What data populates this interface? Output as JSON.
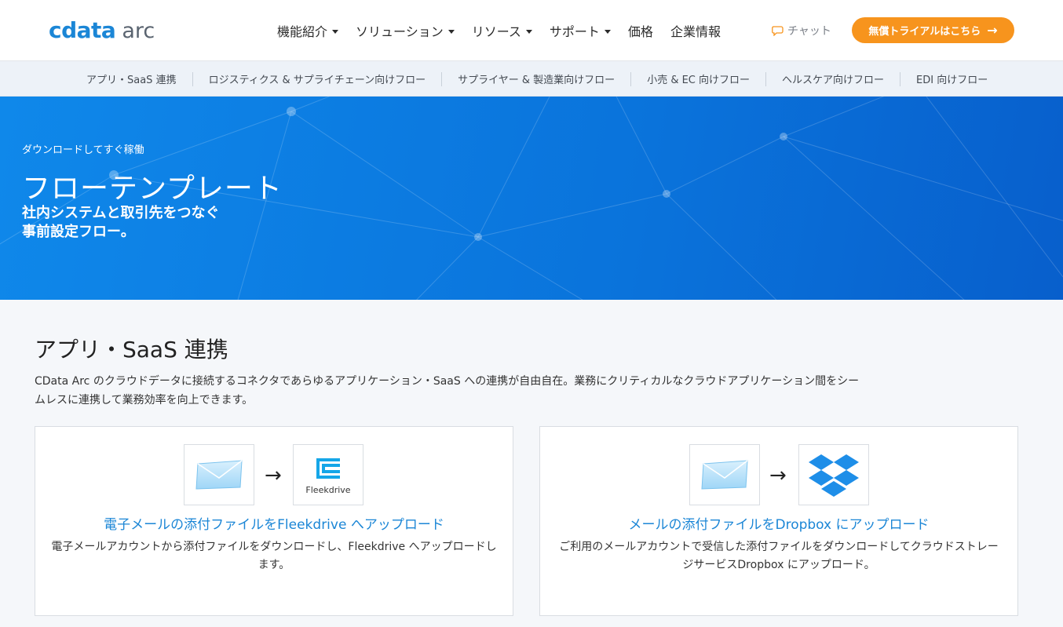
{
  "header": {
    "logo_primary": "cdata",
    "logo_secondary": "arc",
    "nav": [
      {
        "label": "機能紹介",
        "dropdown": true
      },
      {
        "label": "ソリューション",
        "dropdown": true
      },
      {
        "label": "リソース",
        "dropdown": true
      },
      {
        "label": "サポート",
        "dropdown": true
      },
      {
        "label": "価格",
        "dropdown": false
      },
      {
        "label": "企業情報",
        "dropdown": false
      }
    ],
    "chat_label": "チャット",
    "cta_label": "無償トライアルはこちら",
    "cta_arrow": "→"
  },
  "subnav": {
    "items": [
      "アプリ・SaaS 連携",
      "ロジスティクス & サプライチェーン向けフロー",
      "サプライヤー & 製造業向けフロー",
      "小売 & EC 向けフロー",
      "ヘルスケア向けフロー",
      "EDI 向けフロー"
    ]
  },
  "hero": {
    "eyebrow": "ダウンロードしてすぐ稼働",
    "title": "フローテンプレート",
    "subtitle_line1": "社内システムと取引先をつなぐ",
    "subtitle_line2": "事前設定フロー。"
  },
  "section": {
    "title": "アプリ・SaaS 連携",
    "description": "CData Arc のクラウドデータに接続するコネクタであらゆるアプリケーション・SaaS への連携が自由自在。業務にクリティカルなクラウドアプリケーション間をシームレスに連携して業務効率を向上できます。"
  },
  "cards": [
    {
      "title": "電子メールの添付ファイルをFleekdrive へアップロード",
      "description": "電子メールアカウントから添付ファイルをダウンロードし、Fleekdrive へアップロードします。",
      "source_icon": "email-envelope-icon",
      "target_icon": "fleekdrive-logo-icon",
      "target_label": "Fleekdrive",
      "arrow": "→"
    },
    {
      "title": "メールの添付ファイルをDropbox にアップロード",
      "description": "ご利用のメールアカウントで受信した添付ファイルをダウンロードしてクラウドストレージサービスDropbox にアップロード。",
      "source_icon": "email-envelope-icon",
      "target_icon": "dropbox-logo-icon",
      "arrow": "→"
    }
  ],
  "colors": {
    "brand_blue": "#1b86d6",
    "cta_orange": "#f7941d",
    "hero_blue": "#0a73db"
  }
}
